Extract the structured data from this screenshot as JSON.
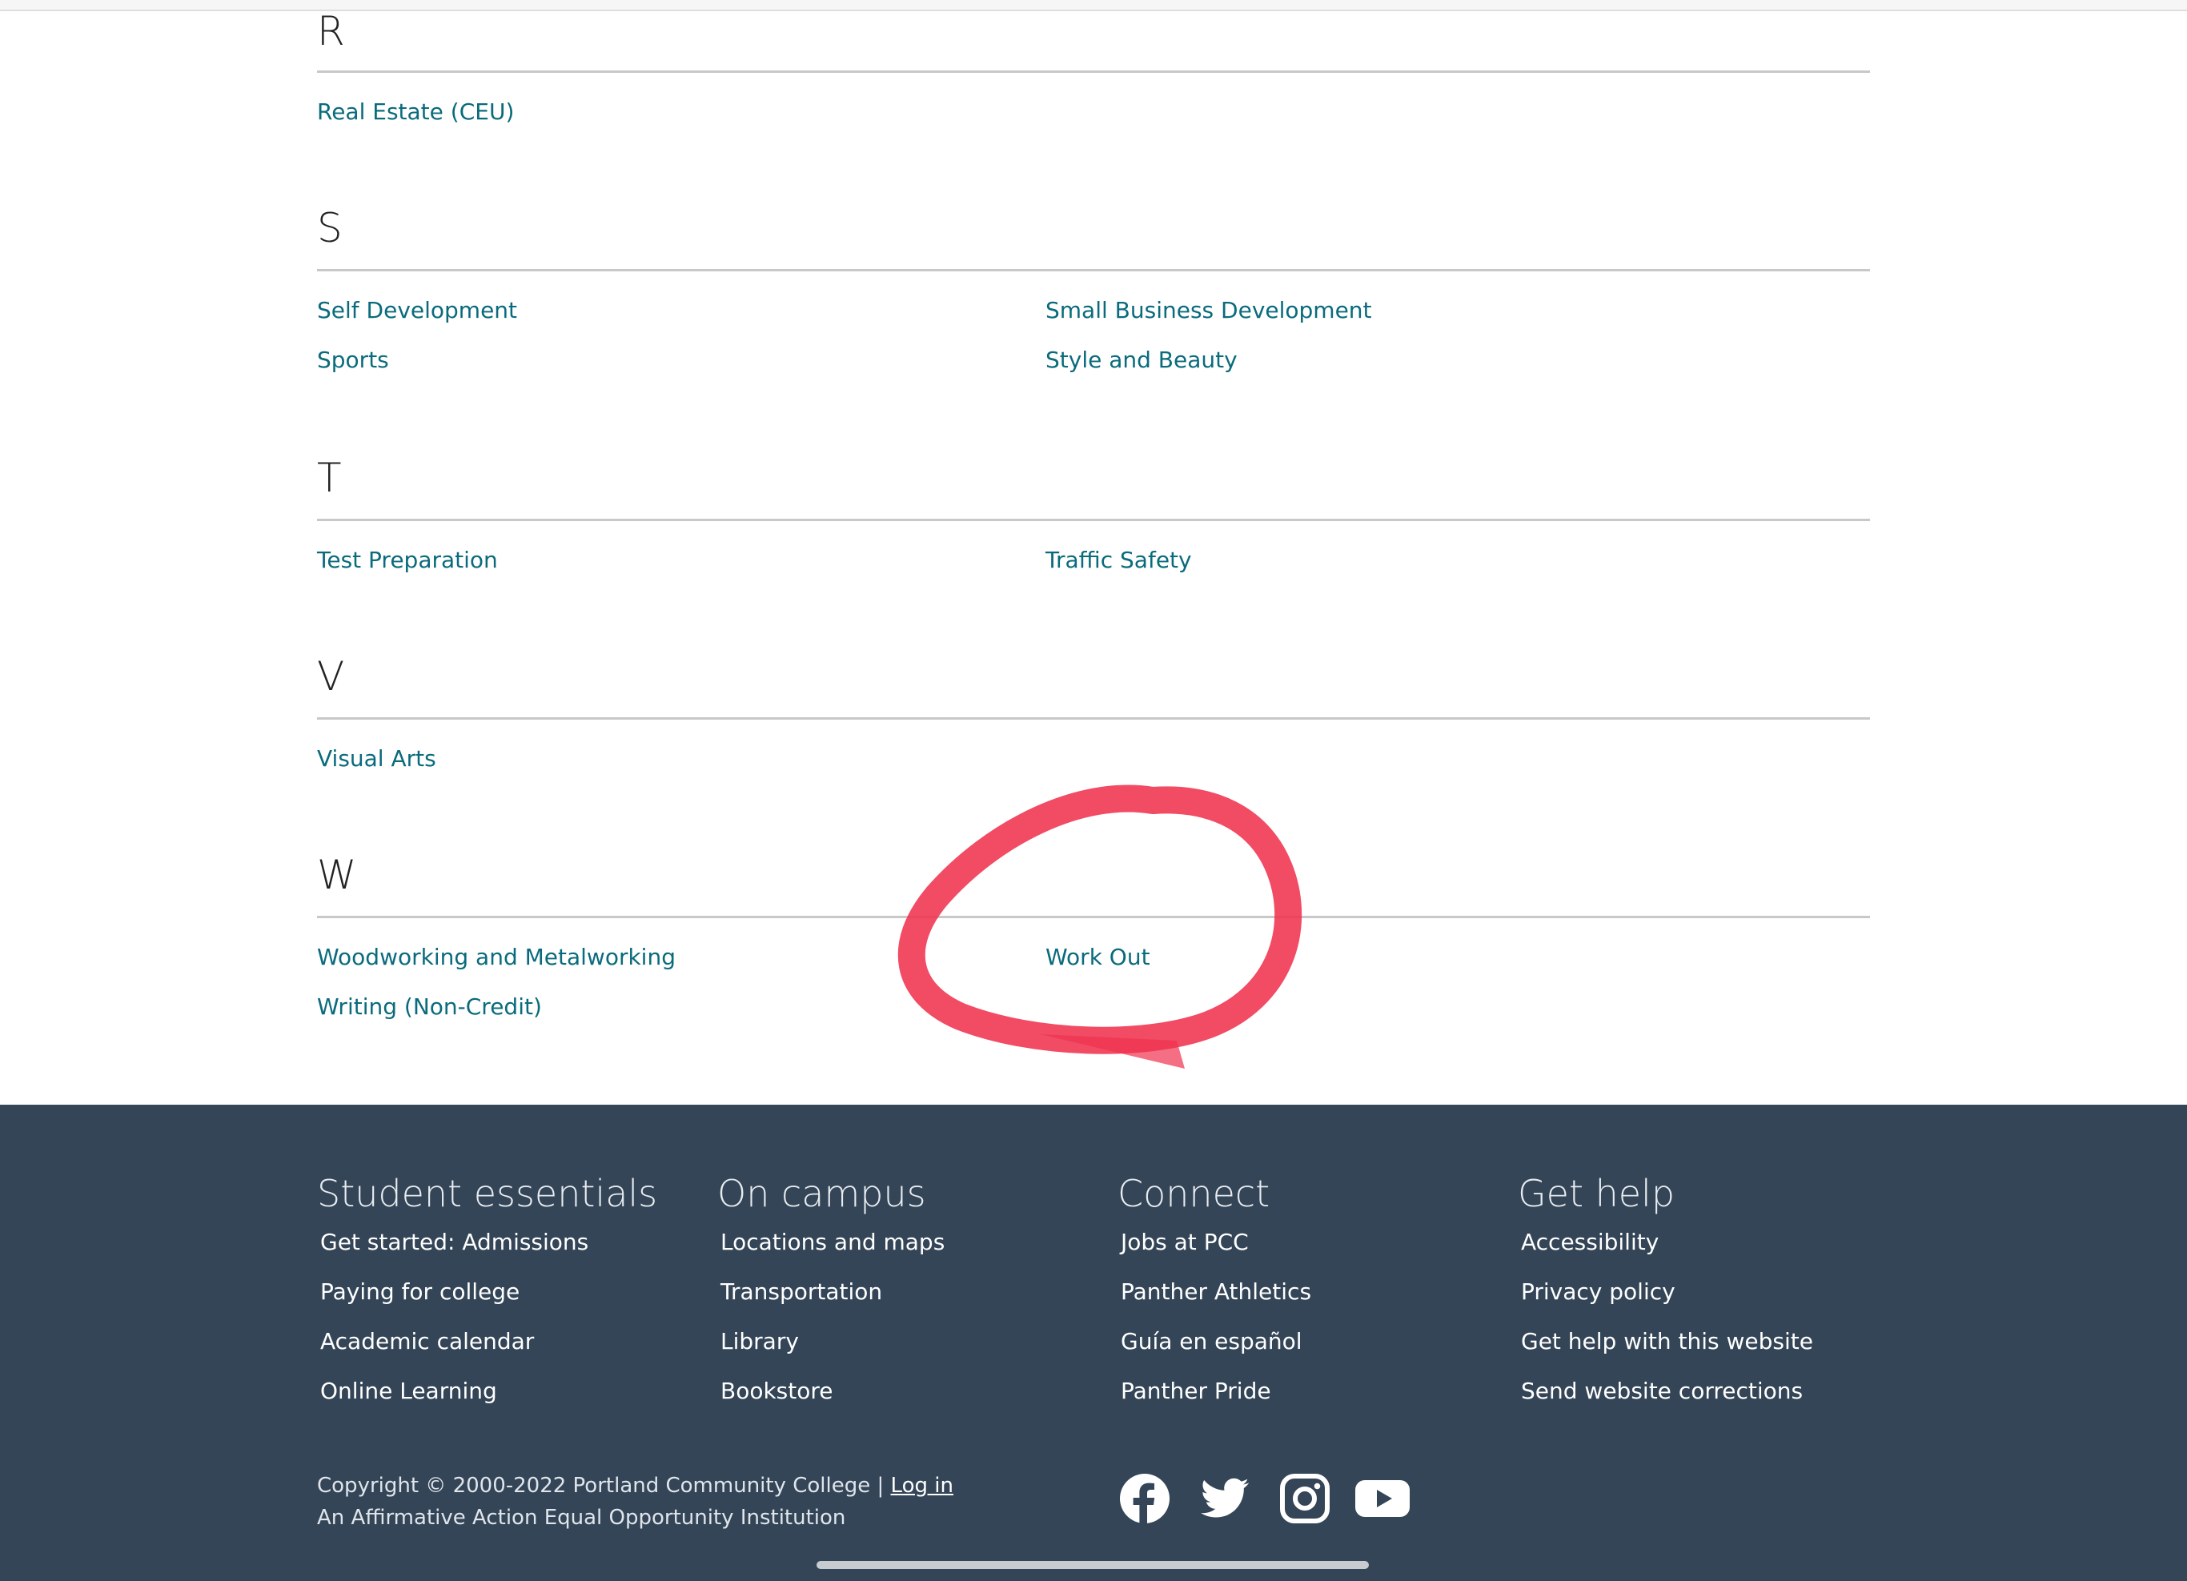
{
  "sections": [
    {
      "letter": "R",
      "links": [
        "Real Estate (CEU)"
      ]
    },
    {
      "letter": "S",
      "links": [
        "Self Development",
        "Small Business Development",
        "Sports",
        "Style and Beauty"
      ]
    },
    {
      "letter": "T",
      "links": [
        "Test Preparation",
        "Traffic Safety"
      ]
    },
    {
      "letter": "V",
      "links": [
        "Visual Arts"
      ]
    },
    {
      "letter": "W",
      "links": [
        "Woodworking and Metalworking",
        "Work Out",
        "Writing (Non-Credit)"
      ]
    }
  ],
  "footer": {
    "columns": [
      {
        "heading": "Student essentials",
        "items": [
          "Get started: Admissions",
          "Paying for college",
          "Academic calendar",
          "Online Learning"
        ]
      },
      {
        "heading": "On campus",
        "items": [
          "Locations and maps",
          "Transportation",
          "Library",
          "Bookstore"
        ]
      },
      {
        "heading": "Connect",
        "items": [
          "Jobs at PCC",
          "Panther Athletics",
          "Guía en español",
          "Panther Pride"
        ]
      },
      {
        "heading": "Get help",
        "items": [
          "Accessibility",
          "Privacy policy",
          "Get help with this website",
          "Send website corrections"
        ]
      }
    ],
    "copyright": "Copyright © 2000-2022 Portland Community College |",
    "login": "Log in",
    "tagline": "An Affirmative Action Equal Opportunity Institution",
    "social": [
      "facebook-icon",
      "twitter-icon",
      "instagram-icon",
      "youtube-icon"
    ]
  },
  "colors": {
    "link": "#0a6b7c",
    "footer_bg": "#344557",
    "annotation": "#f0324f"
  }
}
